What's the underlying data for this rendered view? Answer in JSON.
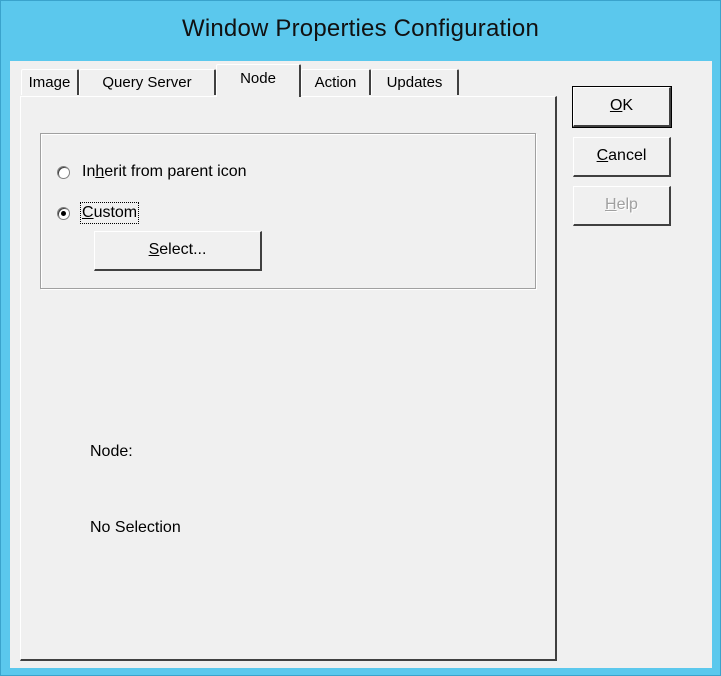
{
  "window": {
    "title": "Window Properties Configuration"
  },
  "tabs": [
    {
      "label": "Image",
      "active": false
    },
    {
      "label": "Query Server",
      "active": false
    },
    {
      "label": "Node",
      "active": true
    },
    {
      "label": "Action",
      "active": false
    },
    {
      "label": "Updates",
      "active": false
    }
  ],
  "node_tab": {
    "options": [
      {
        "pre": "In",
        "mnemonic": "h",
        "post": "erit from parent icon",
        "selected": false
      },
      {
        "pre": "",
        "mnemonic": "C",
        "post": "ustom",
        "selected": true
      }
    ],
    "select_button": {
      "pre": "",
      "mnemonic": "S",
      "post": "elect..."
    },
    "node_label": "Node:",
    "node_value": "No Selection"
  },
  "buttons": {
    "ok": {
      "pre": "",
      "mnemonic": "O",
      "post": "K",
      "enabled": true
    },
    "cancel": {
      "pre": "",
      "mnemonic": "C",
      "post": "ancel",
      "enabled": true
    },
    "help": {
      "pre": "",
      "mnemonic": "H",
      "post": "elp",
      "enabled": false
    }
  }
}
